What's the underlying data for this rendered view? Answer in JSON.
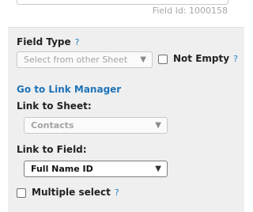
{
  "header": {
    "field_id_text": "Field Id: 1000158"
  },
  "field_type": {
    "label": "Field Type",
    "help": "?",
    "select_placeholder": "Select from other Sheet",
    "not_empty_label": "Not Empty",
    "not_empty_help": "?",
    "not_empty_checked": false
  },
  "link_manager": {
    "label": "Go to Link Manager"
  },
  "link_to_sheet": {
    "label": "Link to Sheet:",
    "selected": "Contacts"
  },
  "link_to_field": {
    "label": "Link to Field:",
    "selected": "Full Name ID"
  },
  "multiple_select": {
    "label": "Multiple select",
    "help": "?",
    "checked": false
  },
  "icons": {
    "dropdown": "chevron-down-icon",
    "help": "question-mark-icon"
  },
  "colors": {
    "panel_bg": "#efefef",
    "link": "#1f73b7",
    "help": "#1f7fc4"
  }
}
